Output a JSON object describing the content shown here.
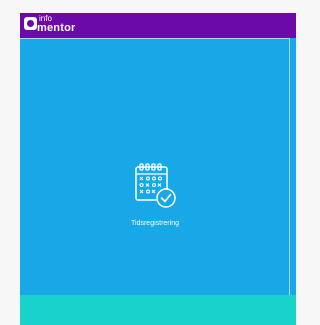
{
  "app": {
    "logo_text_top": "info",
    "logo_text_bottom": "mentor",
    "header_color": "#6b0aa8"
  },
  "tiles": [
    {
      "label": "Tidsregistrering",
      "icon": "calendar-check-icon",
      "color": "#18a8e8"
    }
  ],
  "bottom_tile": {
    "color": "#18d3cc"
  }
}
